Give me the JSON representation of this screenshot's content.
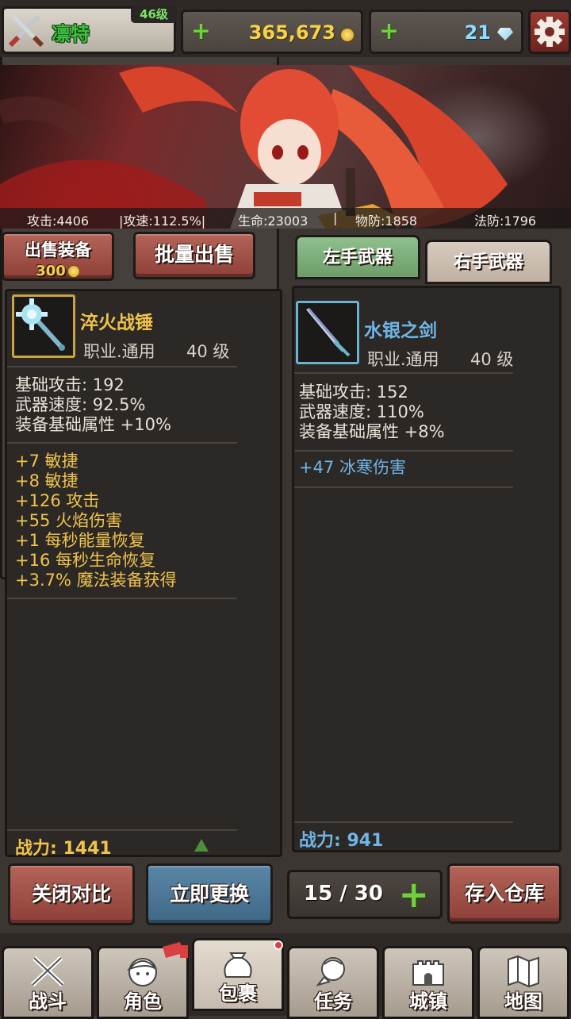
{
  "player": {
    "name": "凛特",
    "level": "46级"
  },
  "currency": {
    "gold": "365,673",
    "gems": "21"
  },
  "stats": {
    "attack": "攻击:4406",
    "attack_speed": "|攻速:112.5%|",
    "hp": "生命:23003",
    "sep": "|",
    "phys_def": "物防:1858",
    "magic_def": "法防:1796"
  },
  "sell": {
    "label": "出售装备",
    "price": "300",
    "batch_label": "批量出售"
  },
  "tabs": [
    {
      "label": "左手武器",
      "selected": true
    },
    {
      "label": "右手武器",
      "selected": false
    }
  ],
  "left_item": {
    "name": "淬火战锤",
    "class": "职业.通用",
    "level": "40 级",
    "base": [
      "基础攻击:  192",
      "武器速度:  92.5%",
      "装备基础属性 +10%"
    ],
    "bonuses": [
      "+7 敏捷",
      "+8 敏捷",
      "+126 攻击",
      "+55 火焰伤害",
      "+1 每秒能量恢复",
      "+16 每秒生命恢复",
      "+3.7% 魔法装备获得"
    ],
    "power": "战力:  1441"
  },
  "right_item": {
    "name": "水银之剑",
    "class": "职业.通用",
    "level": "40 级",
    "base": [
      "基础攻击:  152",
      "武器速度:  110%",
      "装备基础属性 +8%"
    ],
    "bonuses": [
      "+47 冰寒伤害"
    ],
    "power": "战力:  941"
  },
  "actions": {
    "close_compare": "关闭对比",
    "equip_now": "立即更换",
    "capacity": "15 / 30",
    "store": "存入仓库"
  },
  "nav": [
    {
      "label": "战斗",
      "icon": "crossed-swords-icon"
    },
    {
      "label": "角色",
      "icon": "character-icon"
    },
    {
      "label": "包裹",
      "icon": "bag-icon",
      "active": true
    },
    {
      "label": "任务",
      "icon": "quest-icon"
    },
    {
      "label": "城镇",
      "icon": "castle-icon"
    },
    {
      "label": "地图",
      "icon": "map-icon"
    }
  ],
  "colors": {
    "gold": "#f5d24a",
    "green": "#6fd03b",
    "item_name_yellow": "#f0c44a",
    "item_name_blue": "#6fb6e8"
  }
}
